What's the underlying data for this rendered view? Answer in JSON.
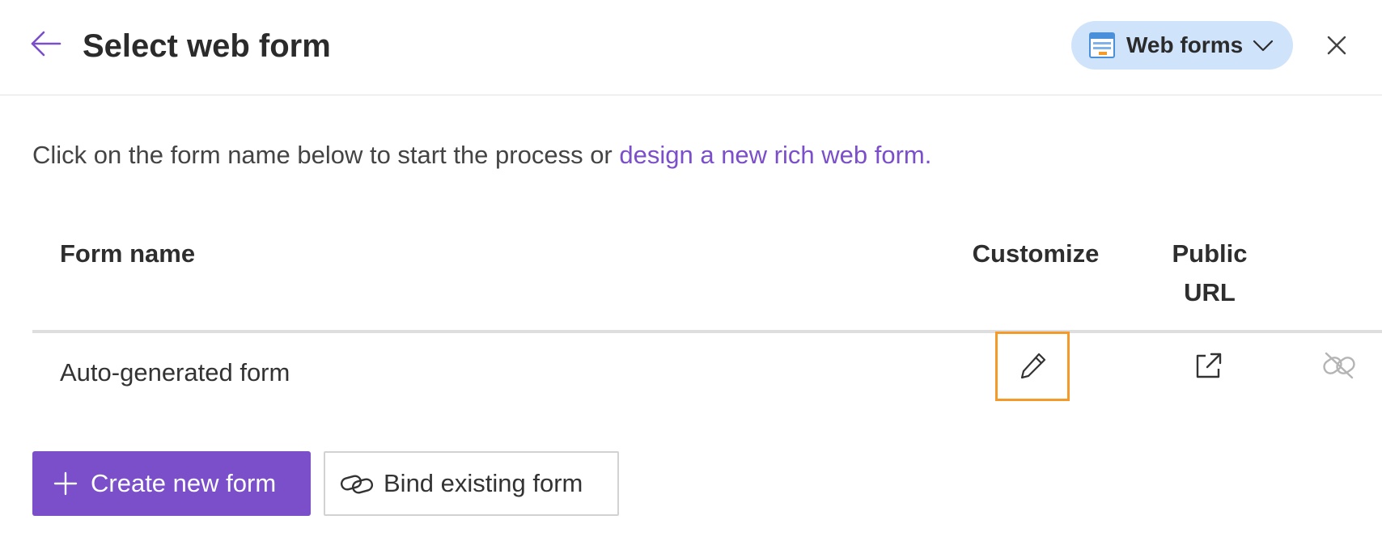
{
  "header": {
    "title": "Select web form",
    "dropdown_label": "Web forms",
    "back_icon": "arrow-left-icon",
    "close_icon": "close-icon"
  },
  "intro": {
    "text": "Click on the form name below to start the process or ",
    "link_text": "design a new rich web form."
  },
  "table": {
    "columns": [
      "Form name",
      "Customize",
      "Public",
      "URL"
    ],
    "rows": [
      {
        "form_name": "Auto-generated form",
        "customize_icon": "pencil-icon",
        "public_url_icon": "external-link-icon",
        "extra_icon": "unlink-icon"
      }
    ]
  },
  "actions": {
    "create_label": "Create new form",
    "bind_label": "Bind existing form"
  },
  "colors": {
    "accent": "#7a4fc9",
    "dropdown_bg": "#cfe3fb",
    "highlight_border": "#f39a2b"
  }
}
